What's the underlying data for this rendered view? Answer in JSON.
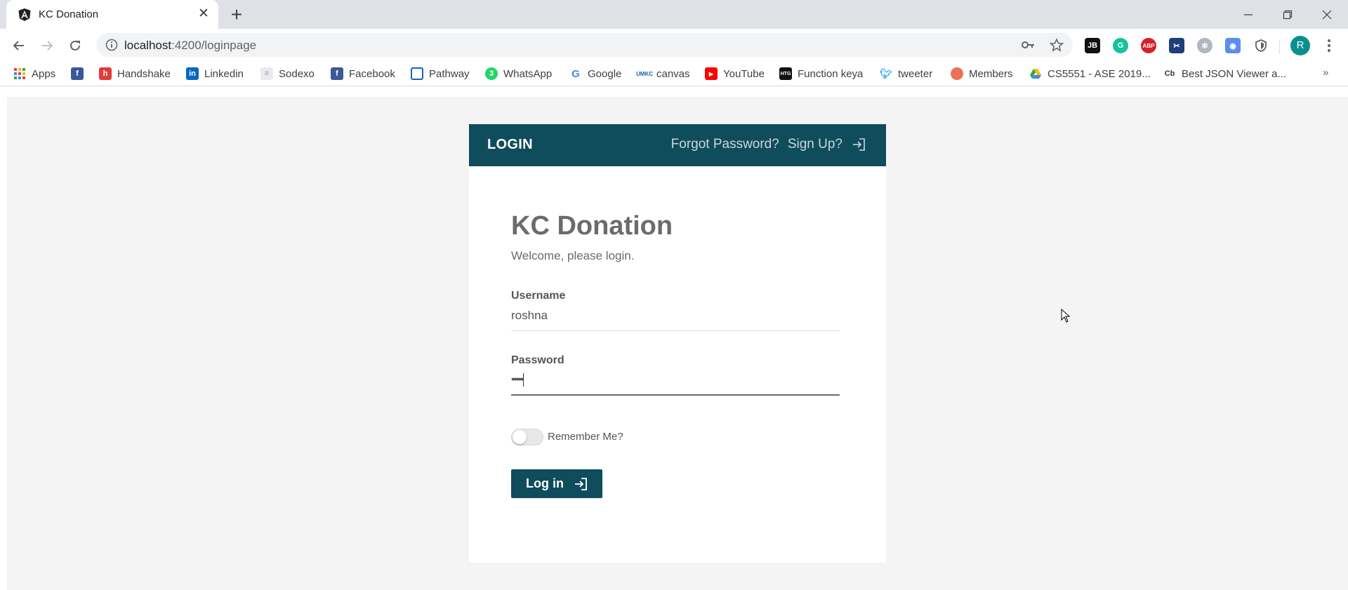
{
  "browser": {
    "tab": {
      "title": "KC Donation"
    },
    "address": {
      "host": "localhost",
      "path": ":4200/loginpage"
    },
    "profile_initial": "R"
  },
  "bookmarks": {
    "items": [
      {
        "label": "Apps",
        "icon": "apps-grid-icon",
        "color": "#ea4335"
      },
      {
        "label": "",
        "icon": "facebook-icon",
        "color": "#3b5998"
      },
      {
        "label": "Handshake",
        "icon": "handshake-icon",
        "color": "#e23b3b"
      },
      {
        "label": "Linkedin",
        "icon": "linkedin-icon",
        "color": "#0a66c2"
      },
      {
        "label": "Sodexo",
        "icon": "document-icon",
        "color": "#9aa0a6"
      },
      {
        "label": "Facebook",
        "icon": "facebook-icon",
        "color": "#3b5998"
      },
      {
        "label": "Pathway",
        "icon": "pathway-icon",
        "color": "#1565c0"
      },
      {
        "label": "WhatsApp",
        "icon": "whatsapp-icon",
        "color": "#25d366"
      },
      {
        "label": "Google",
        "icon": "google-icon",
        "color": "#4285f4"
      },
      {
        "label": "canvas",
        "icon": "umkc-icon",
        "color": "#1a5fb4"
      },
      {
        "label": "YouTube",
        "icon": "youtube-icon",
        "color": "#ff0000"
      },
      {
        "label": "Function keya",
        "icon": "htg-icon",
        "color": "#111111"
      },
      {
        "label": "tweeter",
        "icon": "twitter-icon",
        "color": "#1da1f2"
      },
      {
        "label": "Members",
        "icon": "members-icon",
        "color": "#e8715a"
      },
      {
        "label": "CS5551 - ASE 2019...",
        "icon": "google-drive-icon",
        "color": "#fbbc04"
      },
      {
        "label": "Best JSON Viewer a...",
        "icon": "cb-icon",
        "color": "#333333"
      }
    ],
    "more": "»"
  },
  "card": {
    "header_title": "LOGIN",
    "forgot_password": "Forgot Password?",
    "sign_up": "Sign Up?",
    "app_title": "KC Donation",
    "welcome": "Welcome, please login.",
    "username_label": "Username",
    "username_value": "roshna",
    "password_label": "Password",
    "password_value": "•••••",
    "remember_label": "Remember Me?",
    "login_button": "Log in"
  },
  "colors": {
    "brand": "#0f4c5c",
    "page_background": "#f4f4f4"
  }
}
